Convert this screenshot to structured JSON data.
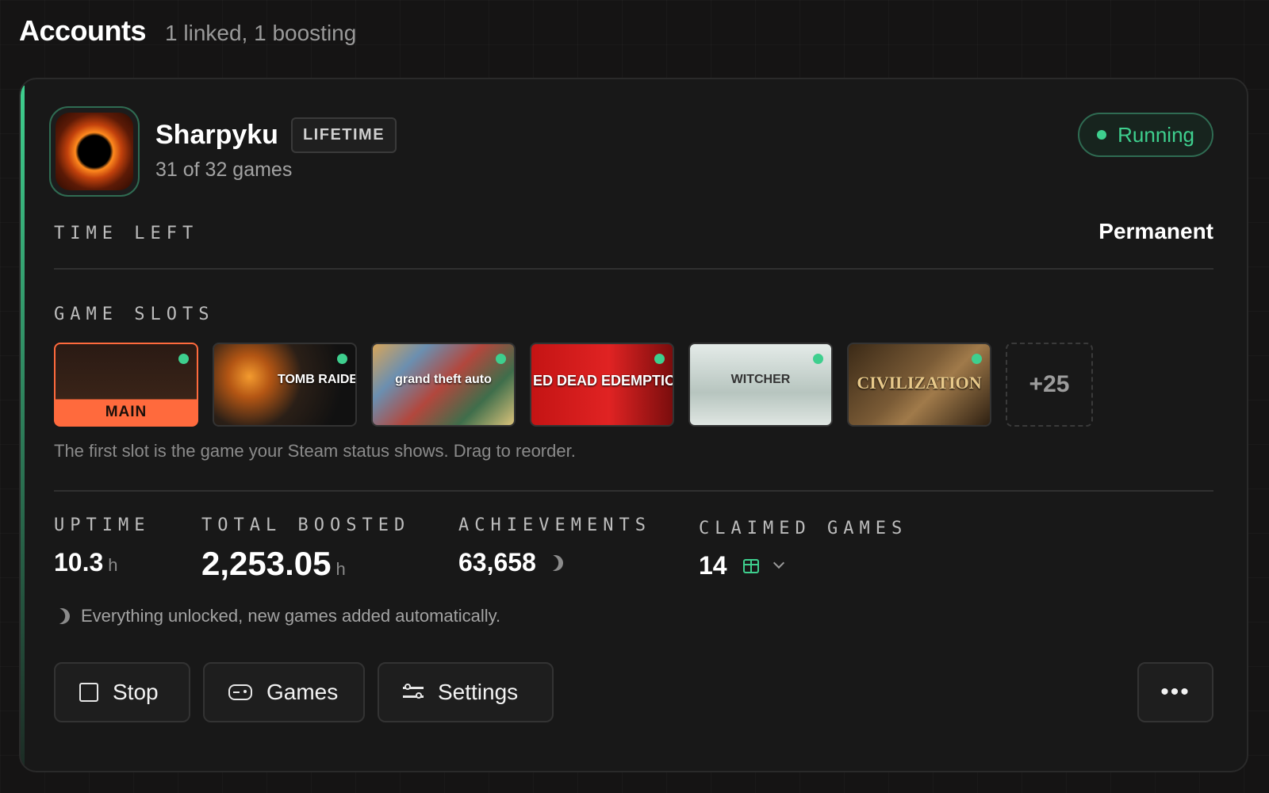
{
  "header": {
    "title": "Accounts",
    "subtitle": "1 linked, 1 boosting"
  },
  "account": {
    "name": "Sharpyku",
    "plan_badge": "LIFETIME",
    "games_count": "31 of 32 games",
    "status": "Running",
    "time_left_label": "TIME LEFT",
    "time_left_value": "Permanent",
    "game_slots_label": "GAME SLOTS",
    "slots": [
      {
        "title": "",
        "tag": "MAIN"
      },
      {
        "title": "TOMB RAIDE"
      },
      {
        "title": "grand theft auto"
      },
      {
        "title": "ED DEAD EDEMPTION II"
      },
      {
        "title": "WITCHER"
      },
      {
        "title": "CIVILIZATION"
      }
    ],
    "more_slots": "+25",
    "slots_hint": "The first slot is the game your Steam status shows. Drag to reorder."
  },
  "stats": {
    "uptime": {
      "label": "UPTIME",
      "value": "10.3",
      "unit": "h"
    },
    "total_boosted": {
      "label": "TOTAL BOOSTED",
      "value": "2,253.05",
      "unit": "h"
    },
    "achievements": {
      "label": "ACHIEVEMENTS",
      "value": "63,658"
    },
    "claimed_games": {
      "label": "CLAIMED GAMES",
      "value": "14"
    }
  },
  "note": "Everything unlocked, new games added automatically.",
  "actions": {
    "stop": "Stop",
    "games": "Games",
    "settings": "Settings",
    "more": "•••"
  },
  "colors": {
    "accent": "#3ecf8e",
    "main_slot": "#ff6a3d",
    "background": "#151414",
    "card": "#181818"
  },
  "icons": [
    "moon-icon",
    "gift-icon",
    "chevron-down-icon",
    "stop-square-icon",
    "gamepad-icon",
    "sliders-icon",
    "ellipsis-icon"
  ]
}
